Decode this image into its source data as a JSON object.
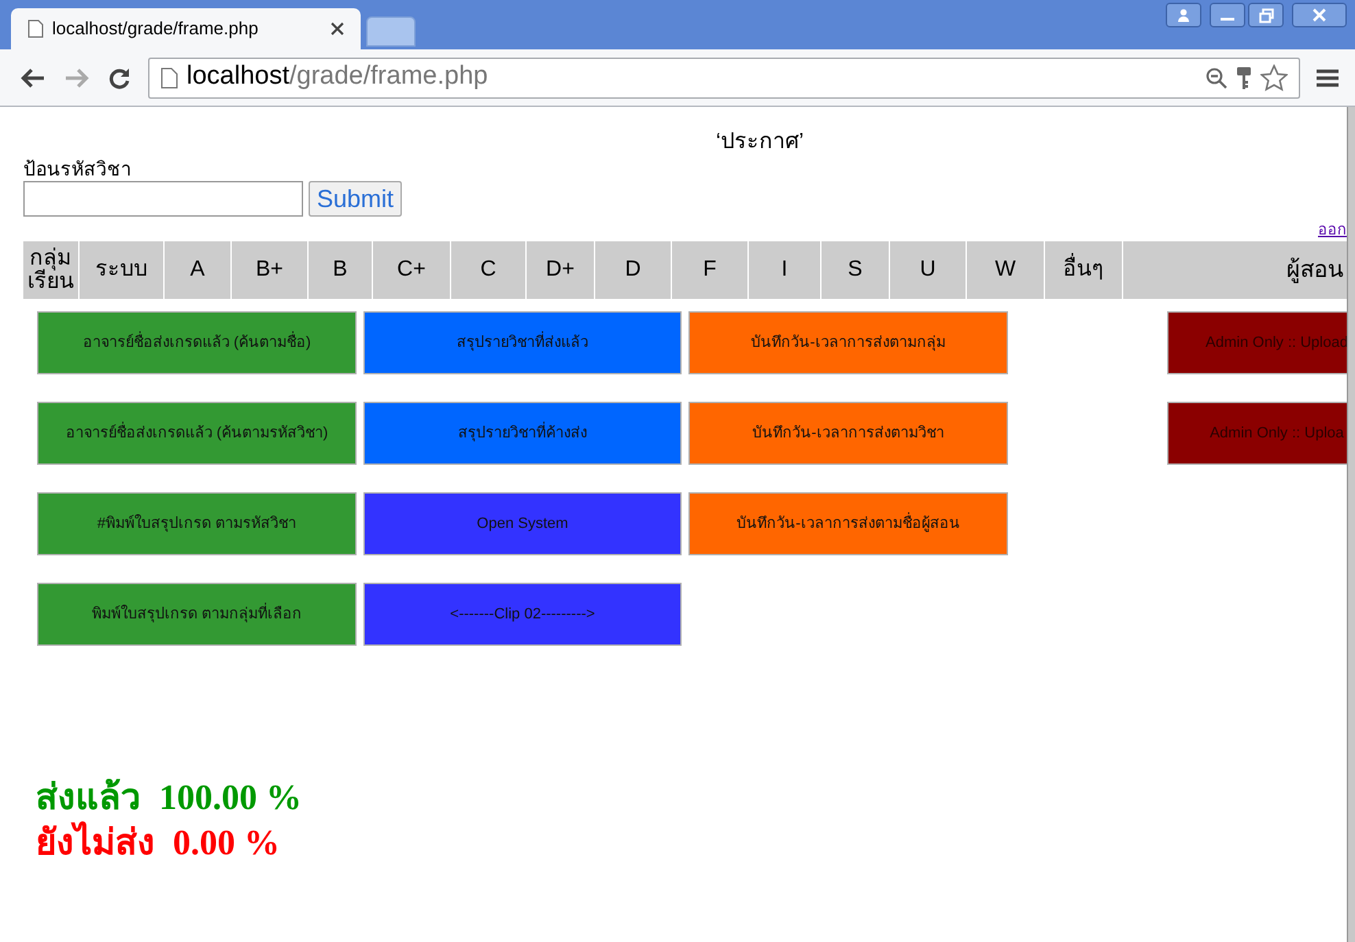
{
  "browser": {
    "tab_title": "localhost/grade/frame.php",
    "address": {
      "host": "localhost",
      "path": "/grade/frame.php"
    }
  },
  "heading": "‘ประกาศ’",
  "course_form": {
    "label": "ป้อนรหัสวิชา",
    "submit": "Submit"
  },
  "logout_link": "ออก",
  "grade_table": {
    "columns": [
      "กลุ่ม เรียน",
      "ระบบ",
      "A",
      "B+",
      "B",
      "C+",
      "C",
      "D+",
      "D",
      "F",
      "I",
      "S",
      "U",
      "W",
      "อื่นๆ",
      "ผู้สอน"
    ]
  },
  "button_columns": [
    {
      "buttons": [
        {
          "label": "อาจารย์ชื่อส่งเกรดแล้ว (ค้นตามชื่อ)",
          "color": "#339933"
        },
        {
          "label": "อาจารย์ชื่อส่งเกรดแล้ว (ค้นตามรหัสวิชา)",
          "color": "#339933"
        },
        {
          "label": "#พิมพ์ใบสรุปเกรด ตามรหัสวิชา",
          "color": "#339933"
        },
        {
          "label": "พิมพ์ใบสรุปเกรด ตามกลุ่มที่เลือก",
          "color": "#339933"
        }
      ]
    },
    {
      "buttons": [
        {
          "label": "สรุปรายวิชาที่ส่งแล้ว",
          "color": "#0066ff"
        },
        {
          "label": "สรุปรายวิชาที่ค้างส่ง",
          "color": "#0066ff"
        },
        {
          "label": "Open System",
          "color": "#3333ff"
        },
        {
          "label": "<-------Clip 02--------->",
          "color": "#3333ff"
        }
      ]
    },
    {
      "buttons": [
        {
          "label": "บันทึกวัน-เวลาการส่งตามกลุ่ม",
          "color": "#ff6600"
        },
        {
          "label": "บันทึกวัน-เวลาการส่งตามวิชา",
          "color": "#ff6600"
        },
        {
          "label": "บันทึกวัน-เวลาการส่งตามชื่อผู้สอน",
          "color": "#ff6600"
        }
      ]
    },
    {
      "buttons": [
        {
          "label": "Admin Only :: Upload",
          "color": "#8b0000"
        },
        {
          "label": "Admin Only :: Uploa",
          "color": "#8b0000"
        }
      ]
    }
  ],
  "summary": [
    {
      "label": "ส่งแล้ว",
      "value": "100.00 %",
      "color": "#009900"
    },
    {
      "label": "ยังไม่ส่ง",
      "value": "0.00 %",
      "color": "#ff0000"
    }
  ]
}
